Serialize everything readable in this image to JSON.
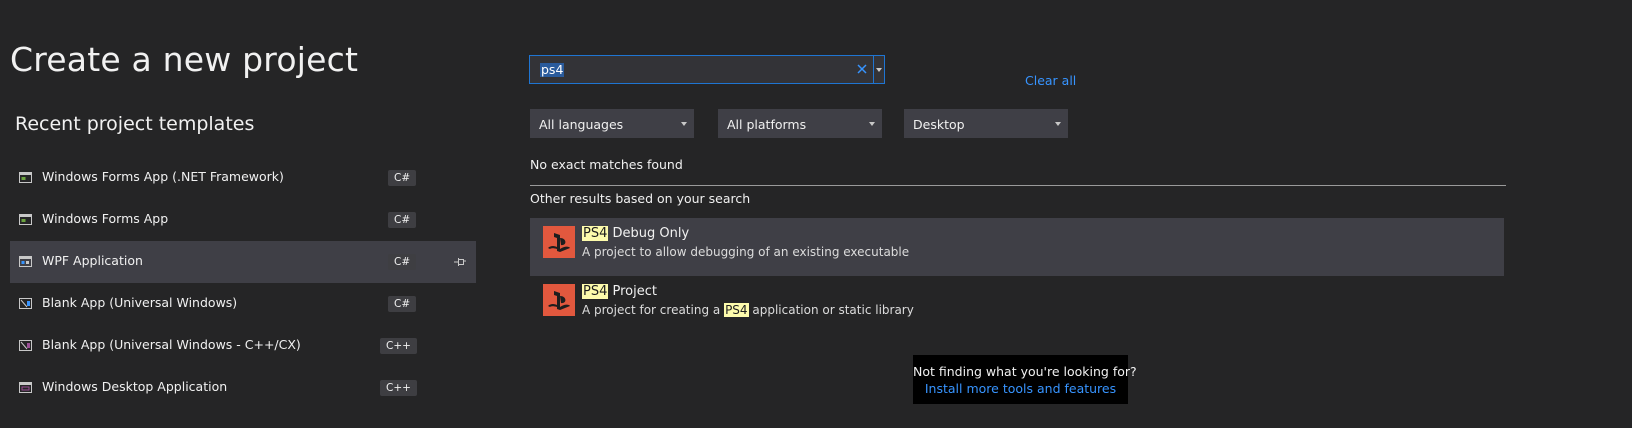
{
  "page": {
    "title": "Create a new project",
    "recent_title": "Recent project templates"
  },
  "recent_templates": [
    {
      "name": "Windows Forms App (.NET Framework)",
      "lang": "C#",
      "icon": "window-form-icon",
      "selected": false
    },
    {
      "name": "Windows Forms App",
      "lang": "C#",
      "icon": "window-form-icon",
      "selected": false
    },
    {
      "name": "WPF Application",
      "lang": "C#",
      "icon": "wpf-window-icon",
      "selected": true,
      "pinned": true
    },
    {
      "name": "Blank App (Universal Windows)",
      "lang": "C#",
      "icon": "uwp-app-icon",
      "selected": false
    },
    {
      "name": "Blank App (Universal Windows - C++/CX)",
      "lang": "C++",
      "icon": "uwp-app-icon",
      "selected": false
    },
    {
      "name": "Windows Desktop Application",
      "lang": "C++",
      "icon": "desktop-app-icon",
      "selected": false
    }
  ],
  "search": {
    "value": "ps4",
    "clear_all": "Clear all"
  },
  "filters": {
    "language": "All languages",
    "platform": "All platforms",
    "project_type": "Desktop"
  },
  "results": {
    "no_match": "No exact matches found",
    "other_header": "Other results based on your search",
    "items": [
      {
        "title_hl": "PS4",
        "title_rest": " Debug Only",
        "desc_before": "A project to allow debugging of an existing executable",
        "desc_hl": "",
        "desc_after": "",
        "selected": true
      },
      {
        "title_hl": "PS4",
        "title_rest": " Project",
        "desc_before": "A project for creating a ",
        "desc_hl": "PS4",
        "desc_after": " application or static library",
        "selected": false
      }
    ]
  },
  "hint": {
    "question": "Not finding what you're looking for?",
    "link": "Install more tools and features"
  },
  "colors": {
    "background": "#252526",
    "accent": "#3794ff",
    "selection": "#3f3f46",
    "playstation_tile": "#e2583e",
    "search_highlight": "#fdfbac"
  }
}
